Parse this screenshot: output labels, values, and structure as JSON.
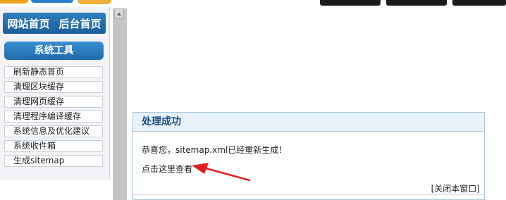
{
  "nav": {
    "site_home": "网站首页",
    "admin_home": "后台首页"
  },
  "sidebar": {
    "title": "系统工具",
    "items": [
      {
        "label": "刷新静态首页"
      },
      {
        "label": "清理区块缓存"
      },
      {
        "label": "清理网页缓存"
      },
      {
        "label": "清理程序编译缓存"
      },
      {
        "label": "系统信息及优化建议"
      },
      {
        "label": "系统收件箱"
      },
      {
        "label": "生成sitemap"
      }
    ]
  },
  "panel": {
    "title": "处理成功",
    "message": "恭喜您，sitemap.xml已经重新生成！",
    "link": "点击这里查看",
    "close": "[关闭本窗口]"
  },
  "colors": {
    "accent": "#1e6aab",
    "annotation_arrow": "#e02020"
  },
  "icons": [
    "scroll-up-icon",
    "annotation-arrow-icon"
  ]
}
